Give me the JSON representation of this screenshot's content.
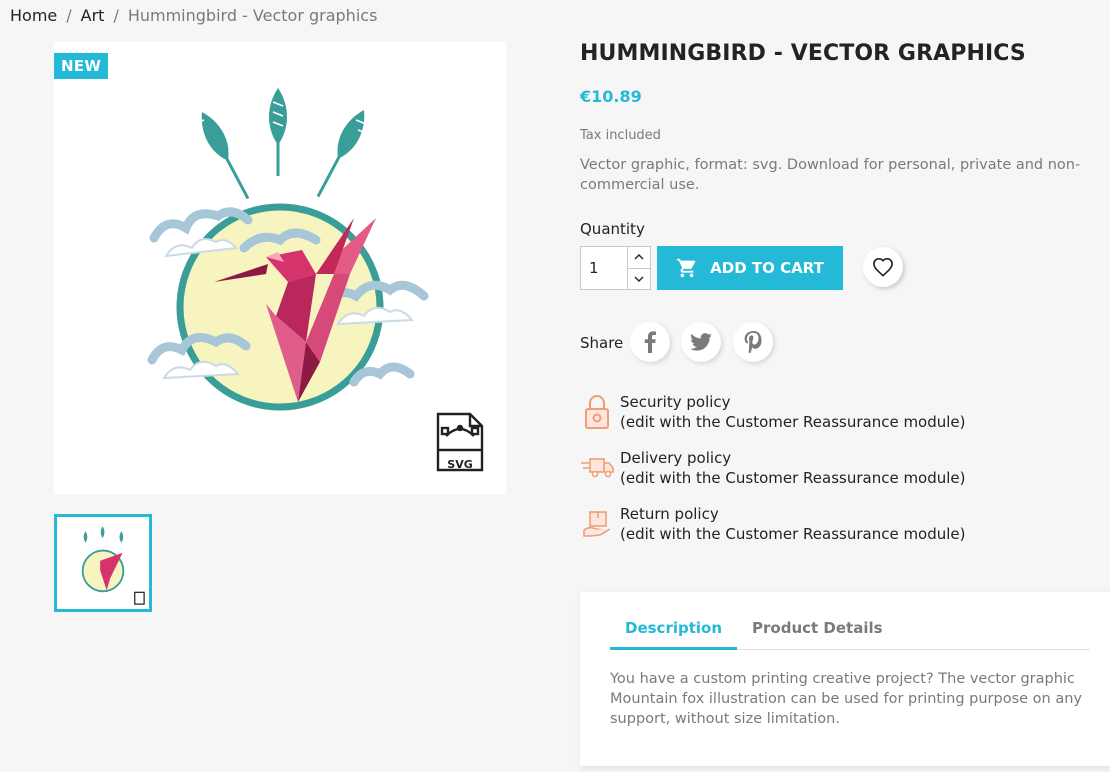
{
  "breadcrumb": {
    "items": [
      "Home",
      "Art"
    ],
    "current": "Hummingbird - Vector graphics"
  },
  "product": {
    "badge": "NEW",
    "title": "HUMMINGBIRD - VECTOR GRAPHICS",
    "price": "€10.89",
    "tax_label": "Tax included",
    "short_description": "Vector graphic, format: svg. Download for personal, private and non-commercial use.",
    "image_format_label": "SVG"
  },
  "purchase": {
    "quantity_label": "Quantity",
    "quantity_value": "1",
    "add_to_cart_label": "ADD TO CART"
  },
  "share": {
    "label": "Share",
    "networks": [
      "facebook-icon",
      "twitter-icon",
      "pinterest-icon"
    ]
  },
  "reassurance": [
    {
      "title": "Security policy",
      "subtitle": "(edit with the Customer Reassurance module)",
      "icon": "lock-icon"
    },
    {
      "title": "Delivery policy",
      "subtitle": "(edit with the Customer Reassurance module)",
      "icon": "delivery-truck-icon"
    },
    {
      "title": "Return policy",
      "subtitle": "(edit with the Customer Reassurance module)",
      "icon": "return-package-icon"
    }
  ],
  "tabs": {
    "items": [
      "Description",
      "Product Details"
    ],
    "active": "Description",
    "description_text": "You have a custom printing creative project? The vector graphic Mountain fox illustration can be used for printing purpose on any support, without size limitation."
  },
  "colors": {
    "accent": "#24b9d7",
    "text": "#232323",
    "muted": "#7a7a7a",
    "background": "#f6f6f6",
    "reassurance_icon": "#f19d76"
  }
}
